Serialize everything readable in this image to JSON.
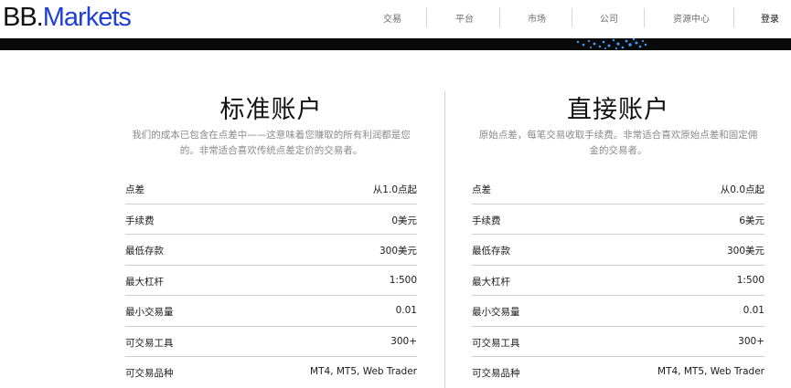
{
  "header": {
    "logo_prefix": "BB.",
    "logo_suffix": "Markets",
    "nav": [
      {
        "label": "交易"
      },
      {
        "label": "平台"
      },
      {
        "label": "市场"
      },
      {
        "label": "公司"
      },
      {
        "label": "资源中心"
      }
    ],
    "login_label": "登录"
  },
  "colors": {
    "brand": "#1f3fd6",
    "banner": "#0a0a0a",
    "banner_accent": "#3aa0ff"
  },
  "accounts": [
    {
      "title": "标准账户",
      "description_line1": "我们的成本已包含在点差中——这意味着您赚取的所有利润都是您",
      "description_line2": "的。非常适合喜欢传统点差定价的交易者。",
      "rows": [
        {
          "label": "点差",
          "value": "从1.0点起"
        },
        {
          "label": "手续费",
          "value": "0美元"
        },
        {
          "label": "最低存款",
          "value": "300美元"
        },
        {
          "label": "最大杠杆",
          "value": "1:500"
        },
        {
          "label": "最小交易量",
          "value": "0.01"
        },
        {
          "label": "可交易工具",
          "value": "300+"
        },
        {
          "label": "可交易品种",
          "value": "MT4, MT5, Web Trader"
        }
      ]
    },
    {
      "title": "直接账户",
      "description_line1": "原始点差，每笔交易收取手续费。非常适合喜欢原始点差和固定佣",
      "description_line2": "金的交易者。",
      "rows": [
        {
          "label": "点差",
          "value": "从0.0点起"
        },
        {
          "label": "手续费",
          "value": "6美元"
        },
        {
          "label": "最低存款",
          "value": "300美元"
        },
        {
          "label": "最大杠杆",
          "value": "1:500"
        },
        {
          "label": "最小交易量",
          "value": "0.01"
        },
        {
          "label": "可交易工具",
          "value": "300+"
        },
        {
          "label": "可交易品种",
          "value": "MT4, MT5, Web Trader"
        }
      ]
    }
  ]
}
